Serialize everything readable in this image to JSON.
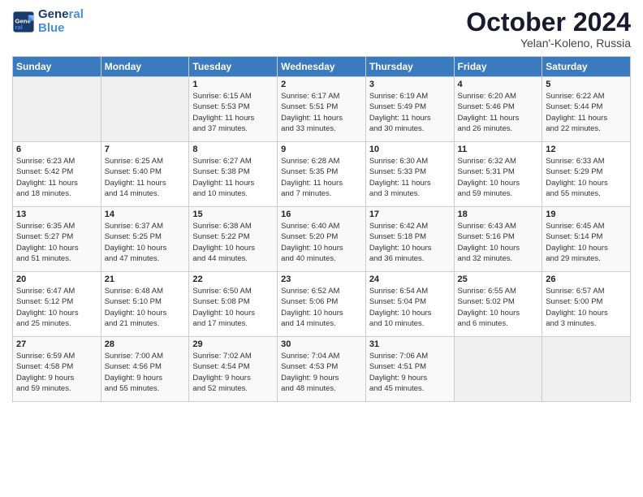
{
  "logo": {
    "line1": "General",
    "line2": "Blue"
  },
  "title": "October 2024",
  "location": "Yelan'-Koleno, Russia",
  "days_of_week": [
    "Sunday",
    "Monday",
    "Tuesday",
    "Wednesday",
    "Thursday",
    "Friday",
    "Saturday"
  ],
  "weeks": [
    [
      {
        "day": "",
        "info": ""
      },
      {
        "day": "",
        "info": ""
      },
      {
        "day": "1",
        "info": "Sunrise: 6:15 AM\nSunset: 5:53 PM\nDaylight: 11 hours\nand 37 minutes."
      },
      {
        "day": "2",
        "info": "Sunrise: 6:17 AM\nSunset: 5:51 PM\nDaylight: 11 hours\nand 33 minutes."
      },
      {
        "day": "3",
        "info": "Sunrise: 6:19 AM\nSunset: 5:49 PM\nDaylight: 11 hours\nand 30 minutes."
      },
      {
        "day": "4",
        "info": "Sunrise: 6:20 AM\nSunset: 5:46 PM\nDaylight: 11 hours\nand 26 minutes."
      },
      {
        "day": "5",
        "info": "Sunrise: 6:22 AM\nSunset: 5:44 PM\nDaylight: 11 hours\nand 22 minutes."
      }
    ],
    [
      {
        "day": "6",
        "info": "Sunrise: 6:23 AM\nSunset: 5:42 PM\nDaylight: 11 hours\nand 18 minutes."
      },
      {
        "day": "7",
        "info": "Sunrise: 6:25 AM\nSunset: 5:40 PM\nDaylight: 11 hours\nand 14 minutes."
      },
      {
        "day": "8",
        "info": "Sunrise: 6:27 AM\nSunset: 5:38 PM\nDaylight: 11 hours\nand 10 minutes."
      },
      {
        "day": "9",
        "info": "Sunrise: 6:28 AM\nSunset: 5:35 PM\nDaylight: 11 hours\nand 7 minutes."
      },
      {
        "day": "10",
        "info": "Sunrise: 6:30 AM\nSunset: 5:33 PM\nDaylight: 11 hours\nand 3 minutes."
      },
      {
        "day": "11",
        "info": "Sunrise: 6:32 AM\nSunset: 5:31 PM\nDaylight: 10 hours\nand 59 minutes."
      },
      {
        "day": "12",
        "info": "Sunrise: 6:33 AM\nSunset: 5:29 PM\nDaylight: 10 hours\nand 55 minutes."
      }
    ],
    [
      {
        "day": "13",
        "info": "Sunrise: 6:35 AM\nSunset: 5:27 PM\nDaylight: 10 hours\nand 51 minutes."
      },
      {
        "day": "14",
        "info": "Sunrise: 6:37 AM\nSunset: 5:25 PM\nDaylight: 10 hours\nand 47 minutes."
      },
      {
        "day": "15",
        "info": "Sunrise: 6:38 AM\nSunset: 5:22 PM\nDaylight: 10 hours\nand 44 minutes."
      },
      {
        "day": "16",
        "info": "Sunrise: 6:40 AM\nSunset: 5:20 PM\nDaylight: 10 hours\nand 40 minutes."
      },
      {
        "day": "17",
        "info": "Sunrise: 6:42 AM\nSunset: 5:18 PM\nDaylight: 10 hours\nand 36 minutes."
      },
      {
        "day": "18",
        "info": "Sunrise: 6:43 AM\nSunset: 5:16 PM\nDaylight: 10 hours\nand 32 minutes."
      },
      {
        "day": "19",
        "info": "Sunrise: 6:45 AM\nSunset: 5:14 PM\nDaylight: 10 hours\nand 29 minutes."
      }
    ],
    [
      {
        "day": "20",
        "info": "Sunrise: 6:47 AM\nSunset: 5:12 PM\nDaylight: 10 hours\nand 25 minutes."
      },
      {
        "day": "21",
        "info": "Sunrise: 6:48 AM\nSunset: 5:10 PM\nDaylight: 10 hours\nand 21 minutes."
      },
      {
        "day": "22",
        "info": "Sunrise: 6:50 AM\nSunset: 5:08 PM\nDaylight: 10 hours\nand 17 minutes."
      },
      {
        "day": "23",
        "info": "Sunrise: 6:52 AM\nSunset: 5:06 PM\nDaylight: 10 hours\nand 14 minutes."
      },
      {
        "day": "24",
        "info": "Sunrise: 6:54 AM\nSunset: 5:04 PM\nDaylight: 10 hours\nand 10 minutes."
      },
      {
        "day": "25",
        "info": "Sunrise: 6:55 AM\nSunset: 5:02 PM\nDaylight: 10 hours\nand 6 minutes."
      },
      {
        "day": "26",
        "info": "Sunrise: 6:57 AM\nSunset: 5:00 PM\nDaylight: 10 hours\nand 3 minutes."
      }
    ],
    [
      {
        "day": "27",
        "info": "Sunrise: 6:59 AM\nSunset: 4:58 PM\nDaylight: 9 hours\nand 59 minutes."
      },
      {
        "day": "28",
        "info": "Sunrise: 7:00 AM\nSunset: 4:56 PM\nDaylight: 9 hours\nand 55 minutes."
      },
      {
        "day": "29",
        "info": "Sunrise: 7:02 AM\nSunset: 4:54 PM\nDaylight: 9 hours\nand 52 minutes."
      },
      {
        "day": "30",
        "info": "Sunrise: 7:04 AM\nSunset: 4:53 PM\nDaylight: 9 hours\nand 48 minutes."
      },
      {
        "day": "31",
        "info": "Sunrise: 7:06 AM\nSunset: 4:51 PM\nDaylight: 9 hours\nand 45 minutes."
      },
      {
        "day": "",
        "info": ""
      },
      {
        "day": "",
        "info": ""
      }
    ]
  ]
}
